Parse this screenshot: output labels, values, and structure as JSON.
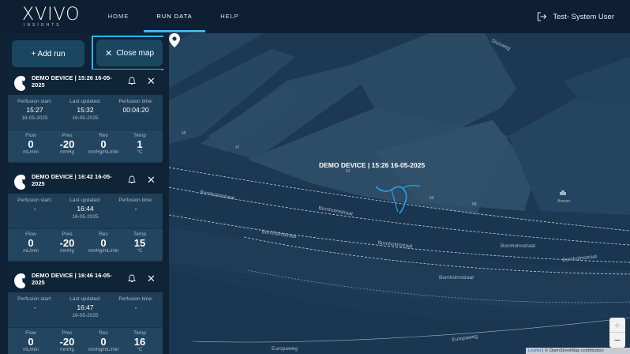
{
  "app": {
    "logo_word": "XVIVO",
    "logo_sub": "INSIGHTS",
    "nav": [
      {
        "label": "HOME",
        "active": false
      },
      {
        "label": "RUN DATA",
        "active": true
      },
      {
        "label": "HELP",
        "active": false
      }
    ],
    "user_label": "Test- System User"
  },
  "toolbar": {
    "add_run_label": "+ Add run",
    "close_map_label": "Close map"
  },
  "runs": [
    {
      "title": "DEMO DEVICE | 15:26 16-05-2025",
      "perfusion_start_label": "Perfusion start:",
      "perfusion_start_time": "15:27",
      "perfusion_start_date": "16-05-2025",
      "last_updated_label": "Last updated:",
      "last_updated_time": "15:32",
      "last_updated_date": "16-05-2025",
      "perfusion_time_label": "Perfusion time:",
      "perfusion_time_value": "00:04:20",
      "metrics": [
        {
          "label": "Flow",
          "value": "0",
          "unit": "mL/min"
        },
        {
          "label": "Pres",
          "value": "-20",
          "unit": "mmHg"
        },
        {
          "label": "Res",
          "value": "0",
          "unit": "mmHg/mL/min"
        },
        {
          "label": "Temp",
          "value": "1",
          "unit": "°C"
        }
      ]
    },
    {
      "title": "DEMO DEVICE | 16:42 16-05-2025",
      "perfusion_start_label": "Perfusion start:",
      "perfusion_start_time": "-",
      "perfusion_start_date": "",
      "last_updated_label": "Last updated:",
      "last_updated_time": "16:44",
      "last_updated_date": "16-05-2025",
      "perfusion_time_label": "Perfusion time:",
      "perfusion_time_value": "-",
      "metrics": [
        {
          "label": "Flow",
          "value": "0",
          "unit": "mL/min"
        },
        {
          "label": "Pres",
          "value": "-20",
          "unit": "mmHg"
        },
        {
          "label": "Res",
          "value": "0",
          "unit": "mmHg/mL/min"
        },
        {
          "label": "Temp",
          "value": "15",
          "unit": "°C"
        }
      ]
    },
    {
      "title": "DEMO DEVICE | 16:46 16-05-2025",
      "perfusion_start_label": "Perfusion start:",
      "perfusion_start_time": "-",
      "perfusion_start_date": "",
      "last_updated_label": "Last updated:",
      "last_updated_time": "16:47",
      "last_updated_date": "16-05-2025",
      "perfusion_time_label": "Perfusion time:",
      "perfusion_time_value": "-",
      "metrics": [
        {
          "label": "Flow",
          "value": "0",
          "unit": "mL/min"
        },
        {
          "label": "Pres",
          "value": "-20",
          "unit": "mmHg"
        },
        {
          "label": "Res",
          "value": "0",
          "unit": "mmHg/mL/min"
        },
        {
          "label": "Temp",
          "value": "16",
          "unit": "°C"
        }
      ]
    }
  ],
  "map": {
    "device_label": "DEMO DEVICE | 15:26 16-05-2025",
    "street_labels": [
      "Bornholmstraat",
      "Europaweg",
      "Sluisweg"
    ],
    "building_numbers": [
      "45",
      "47",
      "53",
      "55",
      "58"
    ],
    "poi_label": "Armon",
    "zoom_in": "+",
    "zoom_out": "−",
    "attribution_leaflet": "Leaflet",
    "attribution_rest": "| © OpenStreetMap contributors"
  },
  "colors": {
    "accent": "#2fb3f0",
    "button_bg": "#1a4660",
    "card_bg": "#1f3e57",
    "map_bg": "#1c3852",
    "track": "#2d9fe3"
  }
}
